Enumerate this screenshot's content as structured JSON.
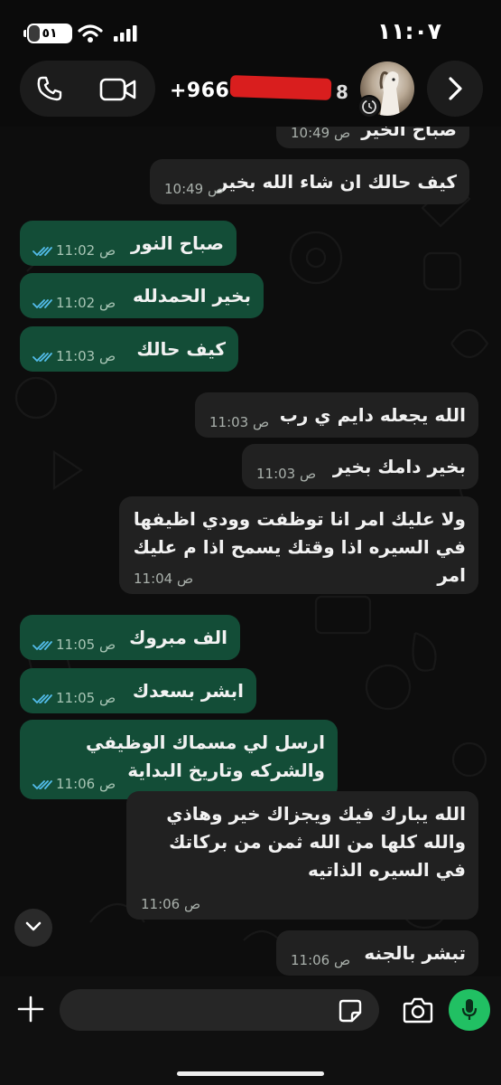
{
  "status": {
    "time": "١١:٠٧",
    "battery_level": "٥١"
  },
  "header": {
    "contact_prefix": "+966",
    "contact_suffix": "8"
  },
  "composer": {
    "placeholder": ""
  },
  "messages": [
    {
      "dir": "in",
      "text": "صباح الخير",
      "time": "10:49 ص"
    },
    {
      "dir": "in",
      "text": "كيف حالك ان شاء الله بخير",
      "time": "10:49 ص"
    },
    {
      "dir": "out",
      "text": "صباح النور",
      "time": "11:02 ص"
    },
    {
      "dir": "out",
      "text": "بخير الحمدلله",
      "time": "11:02 ص"
    },
    {
      "dir": "out",
      "text": "كيف حالك",
      "time": "11:03 ص"
    },
    {
      "dir": "in",
      "text": "الله يجعله دايم ي رب",
      "time": "11:03 ص"
    },
    {
      "dir": "in",
      "text": "بخير دامك بخير",
      "time": "11:03 ص"
    },
    {
      "dir": "in",
      "text": "ولا عليك امر انا توظفت وودي اظيفها في السيره اذا وقتك يسمح اذا م عليك امر",
      "time": "11:04 ص"
    },
    {
      "dir": "out",
      "text": "الف مبروك",
      "time": "11:05 ص"
    },
    {
      "dir": "out",
      "text": "ابشر بسعدك",
      "time": "11:05 ص"
    },
    {
      "dir": "out",
      "text": "ارسل لي مسماك الوظيفي والشركه وتاريخ البداية",
      "time": "11:06 ص"
    },
    {
      "dir": "in",
      "text": "الله يبارك فيك ويجزاك خير وهاذي والله كلها من الله ثمن من بركاتك في السيره الذاتيه",
      "time": "11:06 ص"
    },
    {
      "dir": "in",
      "text": "تبشر بالجنه",
      "time": "11:06 ص"
    }
  ],
  "colors": {
    "incoming_bubble": "#212121",
    "outgoing_bubble": "#134d37",
    "read_ticks": "#53bdeb",
    "mic_button": "#21c063"
  }
}
